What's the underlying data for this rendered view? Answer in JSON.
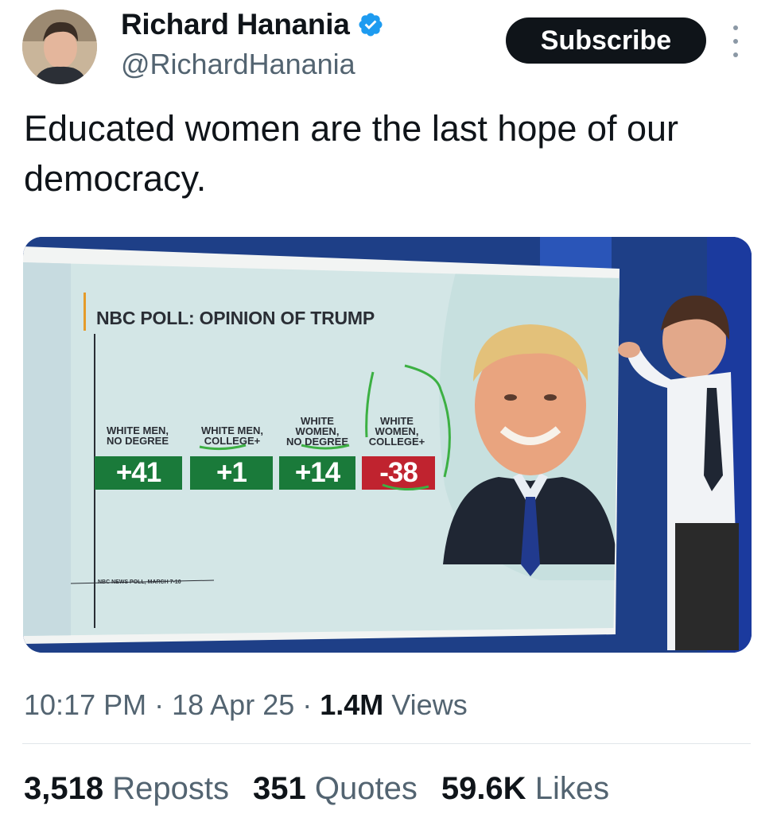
{
  "author": {
    "display_name": "Richard Hanania",
    "handle": "@RichardHanania",
    "verified_badge_icon": "verified-badge-icon"
  },
  "actions": {
    "subscribe_label": "Subscribe",
    "more_icon": "more-vertical-icon"
  },
  "tweet": {
    "text": "Educated women are the last hope of our democracy."
  },
  "media": {
    "board_title": "NBC POLL: OPINION OF TRUMP",
    "columns": [
      {
        "label": "WHITE MEN,\nNO DEGREE",
        "value": "+41",
        "color": "#1a7a3a"
      },
      {
        "label": "WHITE MEN,\nCOLLEGE+",
        "value": "+1",
        "color": "#1a7a3a"
      },
      {
        "label": "WHITE\nWOMEN,\nNO DEGREE",
        "value": "+14",
        "color": "#1a7a3a"
      },
      {
        "label": "WHITE\nWOMEN,\nCOLLEGE+",
        "value": "-38",
        "color": "#c0232f"
      }
    ],
    "footnote": "NBC NEWS POLL, MARCH 7-10"
  },
  "meta": {
    "time": "10:17 PM",
    "date": "18 Apr 25",
    "views_count": "1.4M",
    "views_label": "Views"
  },
  "stats": {
    "reposts_count": "3,518",
    "reposts_label": "Reposts",
    "quotes_count": "351",
    "quotes_label": "Quotes",
    "likes_count": "59.6K",
    "likes_label": "Likes"
  }
}
